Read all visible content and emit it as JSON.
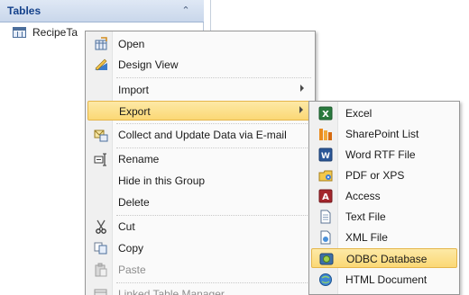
{
  "nav_pane": {
    "header_title": "Tables",
    "collapse_glyph": "»",
    "items": [
      {
        "label": "RecipeTa",
        "icon": "table-icon"
      }
    ]
  },
  "context_menu": {
    "items": [
      {
        "label": "Open",
        "icon": "open-table-icon"
      },
      {
        "label": "Design View",
        "icon": "design-view-icon"
      },
      {
        "label": "Import",
        "has_submenu": true
      },
      {
        "label": "Export",
        "has_submenu": true,
        "active": true
      },
      {
        "label": "Collect and Update Data via E-mail",
        "icon": "collect-data-icon"
      },
      {
        "label": "Rename",
        "icon": "rename-icon"
      },
      {
        "label": "Hide in this Group"
      },
      {
        "label": "Delete"
      },
      {
        "label": "Cut",
        "icon": "scissors-icon"
      },
      {
        "label": "Copy",
        "icon": "copy-icon"
      },
      {
        "label": "Paste",
        "icon": "paste-icon",
        "disabled": true
      },
      {
        "label": "Linked Table Manager",
        "icon": "linked-table-icon",
        "disabled": true
      }
    ]
  },
  "export_submenu": {
    "items": [
      {
        "label": "Excel",
        "icon": "excel-icon"
      },
      {
        "label": "SharePoint List",
        "icon": "sharepoint-icon"
      },
      {
        "label": "Word RTF File",
        "icon": "word-icon"
      },
      {
        "label": "PDF or XPS",
        "icon": "pdf-xps-icon"
      },
      {
        "label": "Access",
        "icon": "access-icon"
      },
      {
        "label": "Text File",
        "icon": "text-file-icon"
      },
      {
        "label": "XML File",
        "icon": "xml-file-icon"
      },
      {
        "label": "ODBC Database",
        "icon": "odbc-database-icon",
        "active": true
      },
      {
        "label": "HTML Document",
        "icon": "html-document-icon"
      }
    ]
  },
  "colors": {
    "highlight_top": "#fde9a6",
    "highlight_bottom": "#fbd875",
    "highlight_border": "#e5b64b",
    "nav_header_text": "#15428b"
  }
}
